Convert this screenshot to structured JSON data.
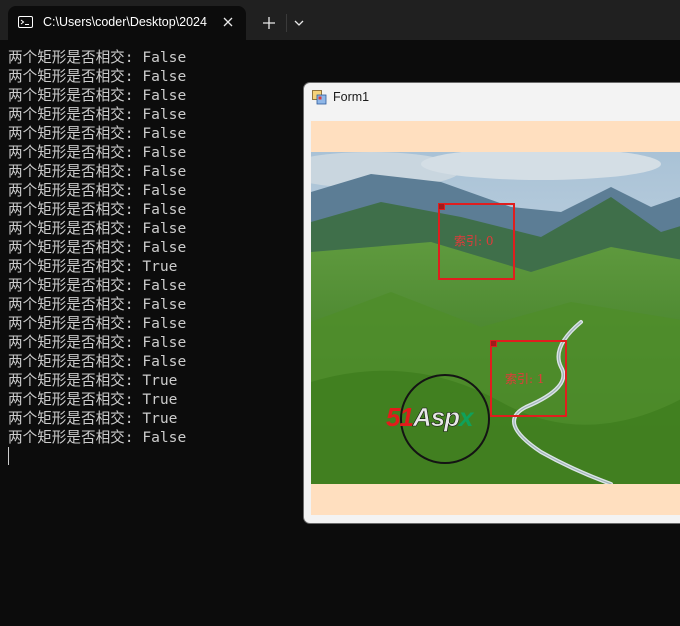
{
  "terminal": {
    "tab_title": "C:\\Users\\coder\\Desktop\\2024",
    "lines": [
      "两个矩形是否相交: False",
      "两个矩形是否相交: False",
      "两个矩形是否相交: False",
      "两个矩形是否相交: False",
      "两个矩形是否相交: False",
      "两个矩形是否相交: False",
      "两个矩形是否相交: False",
      "两个矩形是否相交: False",
      "两个矩形是否相交: False",
      "两个矩形是否相交: False",
      "两个矩形是否相交: False",
      "两个矩形是否相交: True",
      "两个矩形是否相交: False",
      "两个矩形是否相交: False",
      "两个矩形是否相交: False",
      "两个矩形是否相交: False",
      "两个矩形是否相交: False",
      "两个矩形是否相交: True",
      "两个矩形是否相交: True",
      "两个矩形是否相交: True",
      "两个矩形是否相交: False"
    ]
  },
  "form": {
    "title": "Form1",
    "background_color": "#ffdfbf",
    "rectangles": [
      {
        "label": "索引: 0",
        "color": "#e01e1e"
      },
      {
        "label": "索引: 1",
        "color": "#e01e1e"
      }
    ],
    "watermark": {
      "num": "51",
      "word": "Asp",
      "x": "x"
    }
  },
  "colors": {
    "terminal_bg": "#0c0c0c",
    "tabbar_bg": "#202020",
    "console_text": "#cccccc"
  },
  "icons": {
    "tab": "console-icon",
    "close": "close-icon",
    "new_tab": "plus-icon",
    "dropdown": "chevron-down-icon",
    "form": "form-app-icon"
  }
}
